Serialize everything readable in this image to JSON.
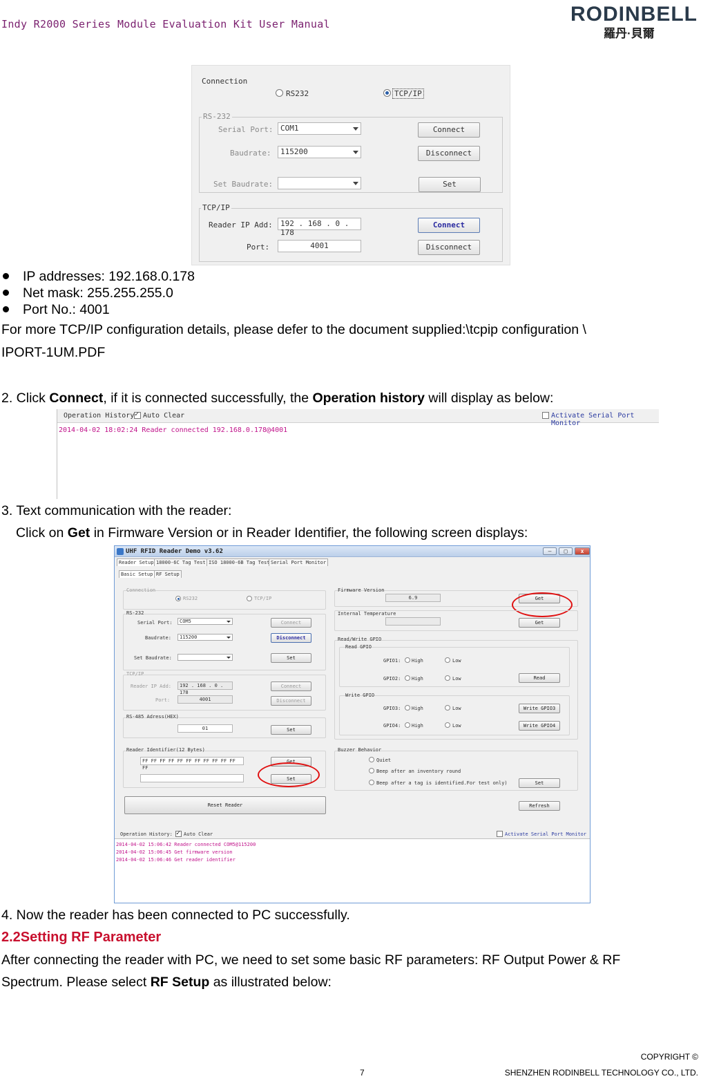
{
  "header": {
    "title": "Indy R2000 Series Module Evaluation Kit User Manual",
    "logo_text": "RODINBELL",
    "logo_cn": "羅丹·貝爾"
  },
  "shot1": {
    "connection_label": "Connection",
    "radio_rs232": "RS232",
    "radio_tcpip": "TCP/IP",
    "rs232_group": "RS-232",
    "serial_port_label": "Serial Port:",
    "serial_port_value": "COM1",
    "baudrate_label": "Baudrate:",
    "baudrate_value": "115200",
    "set_baudrate_label": "Set Baudrate:",
    "connect_btn": "Connect",
    "disconnect_btn": "Disconnect",
    "set_btn": "Set",
    "tcpip_group": "TCP/IP",
    "ip_label": "Reader IP Add:",
    "ip": [
      "192",
      "168",
      "0",
      "178"
    ],
    "port_label": "Port:",
    "port_value": "4001",
    "tcp_connect_btn": "Connect",
    "tcp_disconnect_btn": "Disconnect"
  },
  "bullets": [
    "IP addresses: 192.168.0.178",
    "Net mask: 255.255.255.0",
    "Port No.: 4001"
  ],
  "para1_line1": "For more TCP/IP configuration details, please defer to the document supplied:\\tcpip configuration \\",
  "para1_line2": "IPORT-1UM.PDF",
  "step2": {
    "pre": "2. Click ",
    "b1": "Connect",
    "mid": ", if it is connected successfully, the ",
    "b2": "Operation history",
    "post": " will display as below:"
  },
  "shot2": {
    "op_history_label": "Operation History:",
    "auto_clear_label": "Auto Clear",
    "activate_label": "Activate Serial Port Monitor",
    "log": "2014-04-02 18:02:24 Reader connected  192.168.0.178@4001"
  },
  "step3_line1": "3. Text communication with the reader:",
  "step3_line2": {
    "pre": "Click on ",
    "b": "Get",
    "post": " in Firmware Version or in Reader Identifier, the following screen displays:"
  },
  "shot3": {
    "window_title": "UHF RFID Reader Demo v3.62",
    "tabs": [
      "Reader Setup",
      "18000-6C Tag Test",
      "ISO 18000-6B Tag Test",
      "Serial Port Monitor"
    ],
    "subtabs": [
      "Basic Setup",
      "RF Setup"
    ],
    "connection": "Connection",
    "rs232": "RS232",
    "tcpip": "TCP/IP",
    "rs232_group": "RS-232",
    "serial_port": "Serial Port:",
    "serial_port_val": "COM5",
    "baudrate": "Baudrate:",
    "baudrate_val": "115200",
    "set_baudrate": "Set Baudrate:",
    "connect": "Connect",
    "disconnect": "Disconnect",
    "set": "Set",
    "tcpip_group": "TCP/IP",
    "reader_ip": "Reader IP Add:",
    "ip": "192 . 168 .  0  . 178",
    "port": "Port:",
    "port_val": "4001",
    "rs485": "RS-485 Adress(HEX)",
    "rs485_val": "01",
    "reader_identifier": "Reader Identifier(12 Bytes)",
    "identifier_val": "FF FF FF FF FF FF FF FF FF FF FF FF",
    "reset_reader": "Reset Reader",
    "firmware_version": "Firmware Version",
    "firmware_val": "6.9",
    "get": "Get",
    "internal_temp": "Internal Temperature",
    "rw_gpio": "Read/Write GPIO",
    "read_gpio": "Read GPIO",
    "gpio1": "GPIO1:",
    "gpio2": "GPIO2:",
    "gpio3": "GPIO3:",
    "gpio4": "GPIO4:",
    "high": "High",
    "low": "Low",
    "read": "Read",
    "write_gpio": "Write GPIO",
    "write_gpio3": "Write GPIO3",
    "write_gpio4": "Write GPIO4",
    "buzzer": "Buzzer Behavior",
    "quiet": "Quiet",
    "beep1": "Beep after an inventory round",
    "beep2": "Beep after a tag is identified.For test only)",
    "refresh": "Refresh",
    "op_history": "Operation History:",
    "auto_clear": "Auto Clear",
    "activate": "Activate Serial Port Monitor",
    "log": [
      "2014-04-02 15:06:42 Reader connected COM5@115200",
      "2014-04-02 15:06:45 Get firmware version",
      "2014-04-02 15:06:46 Get reader identifier"
    ],
    "minimize": "—",
    "maximize": "□",
    "close": "x"
  },
  "step4": "4. Now the reader has been connected to PC successfully.",
  "section_heading": "2.2Setting RF Parameter",
  "para2_line1": "After connecting the reader with PC, we need to set some basic RF parameters: RF Output Power & RF",
  "para2_line2": {
    "pre": "Spectrum. Please select ",
    "b": "RF Setup",
    "post": " as illustrated below:"
  },
  "footer": {
    "copyright": "COPYRIGHT ©",
    "page": "7",
    "company": "SHENZHEN RODINBELL TECHNOLOGY CO., LTD."
  },
  "colors": {
    "header": "#7a1f6e",
    "heading": "#c8102e",
    "log": "#c0128a",
    "highlight_ring": "#e01010"
  }
}
